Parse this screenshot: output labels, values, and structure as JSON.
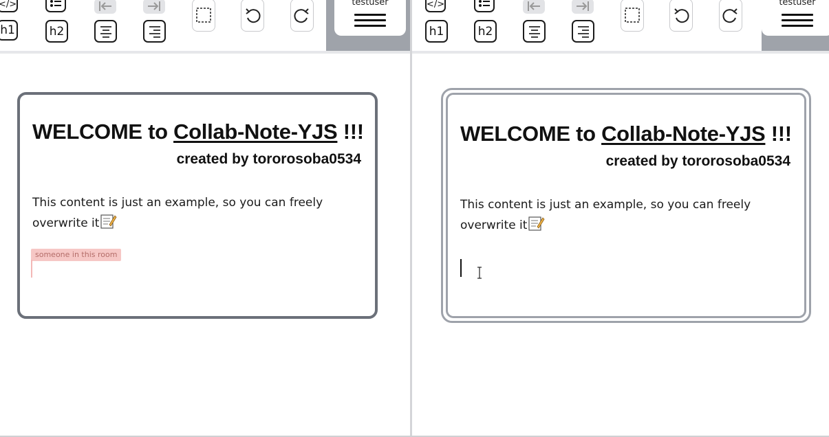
{
  "toolbar": {
    "code_label": "</>",
    "h1_label": "h1",
    "h2_label": "h2"
  },
  "user": {
    "name": "testuser"
  },
  "document": {
    "heading_prefix": "WELCOME to ",
    "heading_link": "Collab-Note-YJS",
    "heading_suffix": " !!!",
    "subheading": "created by tororosoba0534",
    "paragraph": "This content is just an example, so you can freely overwrite it"
  },
  "collaborator": {
    "label": "someone in this room",
    "color": "#f6c7c5"
  },
  "colors": {
    "card_border_left": "#6b7079",
    "card_border_right": "#9ea2aa",
    "user_panel": "#9fa3aa"
  },
  "icons": [
    "code-icon",
    "list-icon",
    "outdent-icon",
    "indent-icon",
    "align-center-icon",
    "align-right-icon",
    "box-icon",
    "undo-icon",
    "redo-icon",
    "menu-icon",
    "memo-icon"
  ]
}
